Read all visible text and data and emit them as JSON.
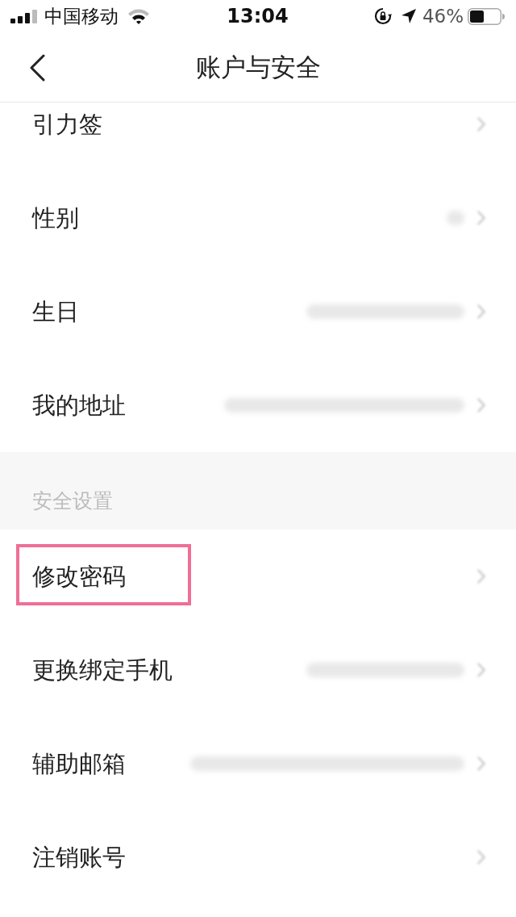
{
  "status_bar": {
    "carrier": "中国移动",
    "time": "13:04",
    "battery_percent": "46%"
  },
  "nav": {
    "title": "账户与安全"
  },
  "sections": [
    {
      "rows": [
        {
          "label": "引力签",
          "kind": "link",
          "highlighted": false
        },
        {
          "label": "性别",
          "kind": "short_value",
          "highlighted": false
        },
        {
          "label": "生日",
          "kind": "long_value",
          "highlighted": false
        },
        {
          "label": "我的地址",
          "kind": "wide_value",
          "highlighted": false
        }
      ]
    },
    {
      "header": "安全设置",
      "rows": [
        {
          "label": "修改密码",
          "kind": "link",
          "highlighted": true
        },
        {
          "label": "更换绑定手机",
          "kind": "long_value",
          "highlighted": false
        },
        {
          "label": "辅助邮箱",
          "kind": "widest_value",
          "highlighted": false
        },
        {
          "label": "注销账号",
          "kind": "link",
          "highlighted": false
        }
      ]
    }
  ]
}
